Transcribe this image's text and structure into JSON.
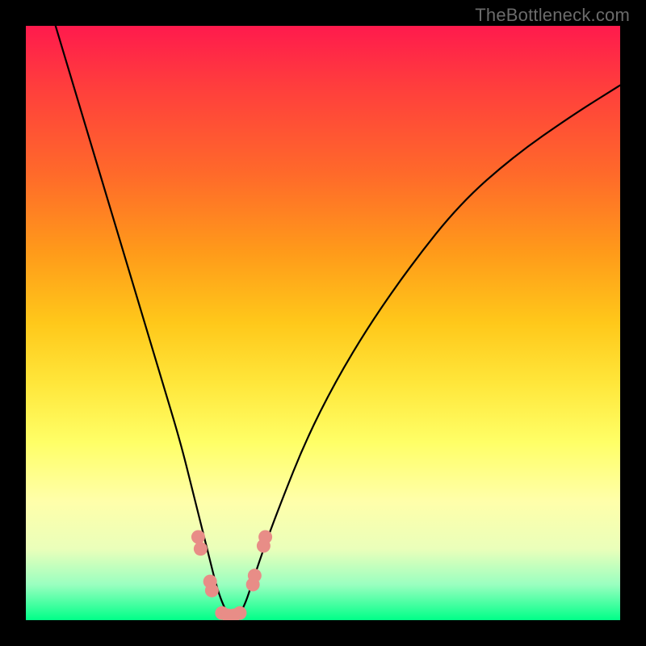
{
  "watermark": "TheBottleneck.com",
  "chart_data": {
    "type": "line",
    "title": "",
    "xlabel": "",
    "ylabel": "",
    "xlim": [
      0,
      100
    ],
    "ylim": [
      0,
      100
    ],
    "series": [
      {
        "name": "bottleneck-curve",
        "x": [
          5,
          8,
          11,
          14,
          17,
          20,
          23,
          26,
          28,
          30,
          31,
          32,
          33,
          34,
          35,
          36,
          37,
          38,
          40,
          43,
          47,
          52,
          58,
          65,
          73,
          82,
          92,
          100
        ],
        "values": [
          100,
          90,
          80,
          70,
          60,
          50,
          40,
          30,
          22,
          14,
          10,
          6,
          3,
          1,
          0,
          1,
          3,
          6,
          12,
          20,
          30,
          40,
          50,
          60,
          70,
          78,
          85,
          90
        ]
      }
    ],
    "markers": {
      "name": "highlight-beads",
      "color": "#e88d87",
      "points": [
        {
          "x": 29.0,
          "y": 14.0
        },
        {
          "x": 29.4,
          "y": 12.0
        },
        {
          "x": 31.0,
          "y": 6.5
        },
        {
          "x": 31.3,
          "y": 5.0
        },
        {
          "x": 33.0,
          "y": 1.2
        },
        {
          "x": 34.0,
          "y": 0.8
        },
        {
          "x": 35.0,
          "y": 0.8
        },
        {
          "x": 36.0,
          "y": 1.2
        },
        {
          "x": 38.2,
          "y": 6.0
        },
        {
          "x": 38.5,
          "y": 7.5
        },
        {
          "x": 40.0,
          "y": 12.5
        },
        {
          "x": 40.3,
          "y": 14.0
        }
      ]
    },
    "gradient_stops": [
      {
        "pos": 0,
        "color": "#ff1a4d"
      },
      {
        "pos": 10,
        "color": "#ff3d3d"
      },
      {
        "pos": 25,
        "color": "#ff6a2a"
      },
      {
        "pos": 38,
        "color": "#ff9a1a"
      },
      {
        "pos": 50,
        "color": "#ffc81a"
      },
      {
        "pos": 60,
        "color": "#ffe63a"
      },
      {
        "pos": 70,
        "color": "#ffff66"
      },
      {
        "pos": 80,
        "color": "#ffffaa"
      },
      {
        "pos": 88,
        "color": "#eaffba"
      },
      {
        "pos": 94,
        "color": "#9affc0"
      },
      {
        "pos": 100,
        "color": "#00ff88"
      }
    ]
  }
}
